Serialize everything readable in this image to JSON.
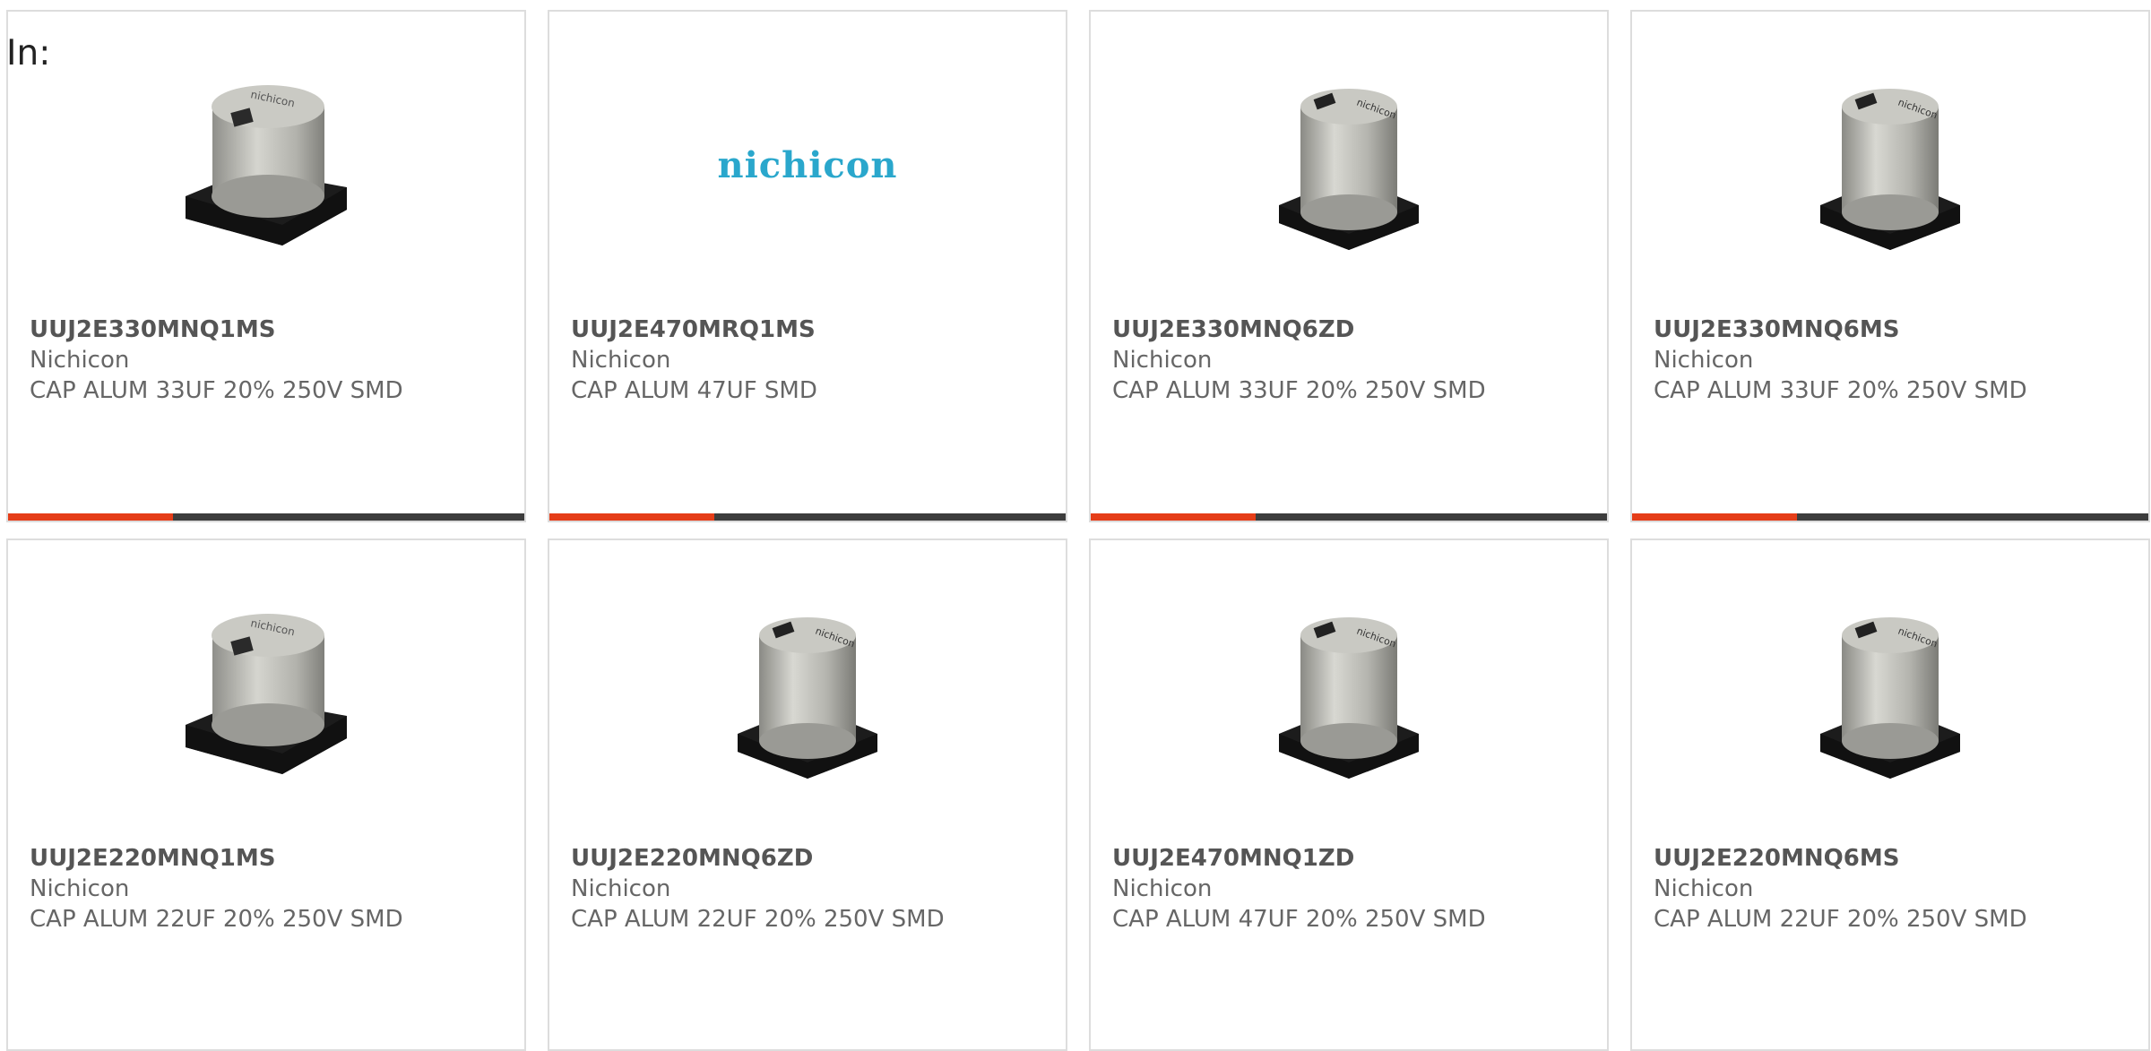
{
  "header": {
    "in_label": "In:"
  },
  "colors": {
    "accent": "#e53d18",
    "bar_track": "#3d3d3d",
    "logo": "#2aa7cc"
  },
  "cards": [
    {
      "part": "UUJ2E330MNQ1MS",
      "manufacturer": "Nichicon",
      "description": "CAP ALUM 33UF 20% 250V SMD",
      "image": "capacitor-wide-icon",
      "progress": 0.32
    },
    {
      "part": "UUJ2E470MRQ1MS",
      "manufacturer": "Nichicon",
      "description": "CAP ALUM 47UF SMD",
      "image": "nichicon-logo",
      "logo_text": "nichicon",
      "progress": 0.32
    },
    {
      "part": "UUJ2E330MNQ6ZD",
      "manufacturer": "Nichicon",
      "description": "CAP ALUM 33UF 20% 250V SMD",
      "image": "capacitor-tall-icon",
      "progress": 0.32
    },
    {
      "part": "UUJ2E330MNQ6MS",
      "manufacturer": "Nichicon",
      "description": "CAP ALUM 33UF 20% 250V SMD",
      "image": "capacitor-tall-icon",
      "progress": 0.32
    },
    {
      "part": "UUJ2E220MNQ1MS",
      "manufacturer": "Nichicon",
      "description": "CAP ALUM 22UF 20% 250V SMD",
      "image": "capacitor-wide-icon"
    },
    {
      "part": "UUJ2E220MNQ6ZD",
      "manufacturer": "Nichicon",
      "description": "CAP ALUM 22UF 20% 250V SMD",
      "image": "capacitor-tall-icon"
    },
    {
      "part": "UUJ2E470MNQ1ZD",
      "manufacturer": "Nichicon",
      "description": "CAP ALUM 47UF 20% 250V SMD",
      "image": "capacitor-tall-icon"
    },
    {
      "part": "UUJ2E220MNQ6MS",
      "manufacturer": "Nichicon",
      "description": "CAP ALUM 22UF 20% 250V SMD",
      "image": "capacitor-tall-icon"
    }
  ]
}
